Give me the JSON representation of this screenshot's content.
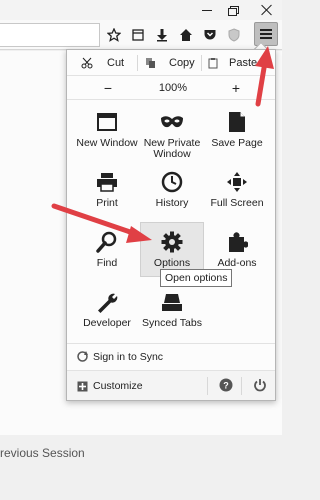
{
  "edit": {
    "cut": "Cut",
    "copy": "Copy",
    "paste": "Paste"
  },
  "zoom": {
    "minus": "−",
    "value": "100%",
    "plus": "+"
  },
  "grid": {
    "new_window": "New Window",
    "new_private_window": "New Private\nWindow",
    "save_page": "Save Page",
    "print": "Print",
    "history": "History",
    "full_screen": "Full Screen",
    "find": "Find",
    "options": "Options",
    "addons": "Add-ons",
    "developer": "Developer",
    "synced_tabs": "Synced Tabs"
  },
  "tooltip": "Open options",
  "sync": {
    "label": "Sign in to Sync"
  },
  "footer": {
    "customize": "Customize"
  },
  "page": {
    "restore_session": "revious Session"
  },
  "colors": {
    "arrow": "#e04045",
    "panel_bg": "#fcfcfc",
    "highlight": "#e6e6e6"
  }
}
